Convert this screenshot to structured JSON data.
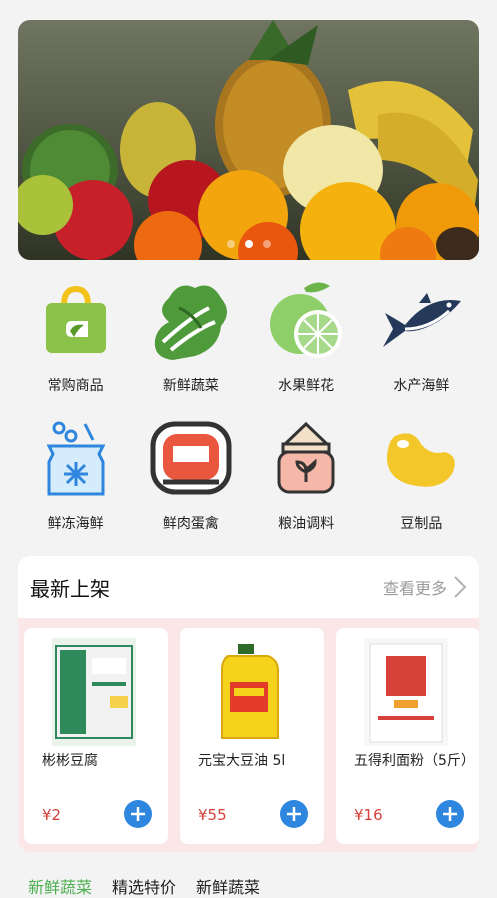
{
  "banner": {
    "dots": [
      false,
      true,
      false
    ]
  },
  "categories": [
    {
      "label": "常购商品",
      "icon": "shopping-bag-icon"
    },
    {
      "label": "新鲜蔬菜",
      "icon": "vegetable-icon"
    },
    {
      "label": "水果鲜花",
      "icon": "lime-icon"
    },
    {
      "label": "水产海鲜",
      "icon": "fish-icon"
    },
    {
      "label": "鲜冻海鲜",
      "icon": "frozen-bag-icon"
    },
    {
      "label": "鲜肉蛋禽",
      "icon": "meat-icon"
    },
    {
      "label": "粮油调料",
      "icon": "grain-sack-icon"
    },
    {
      "label": "豆制品",
      "icon": "bean-icon"
    }
  ],
  "new_arrivals": {
    "title": "最新上架",
    "more_label": "查看更多",
    "products": [
      {
        "name": "彬彬豆腐",
        "price": "¥2"
      },
      {
        "name": "元宝大豆油 5l",
        "price": "¥55"
      },
      {
        "name": "五得利面粉（5斤）",
        "price": "¥16"
      }
    ]
  },
  "bottom_tabs": [
    "新鲜蔬菜",
    "精选特价",
    "新鲜蔬菜"
  ],
  "colors": {
    "accent": "#2f86de",
    "price": "#d8403a",
    "panel_bg": "#fbe7e8"
  }
}
